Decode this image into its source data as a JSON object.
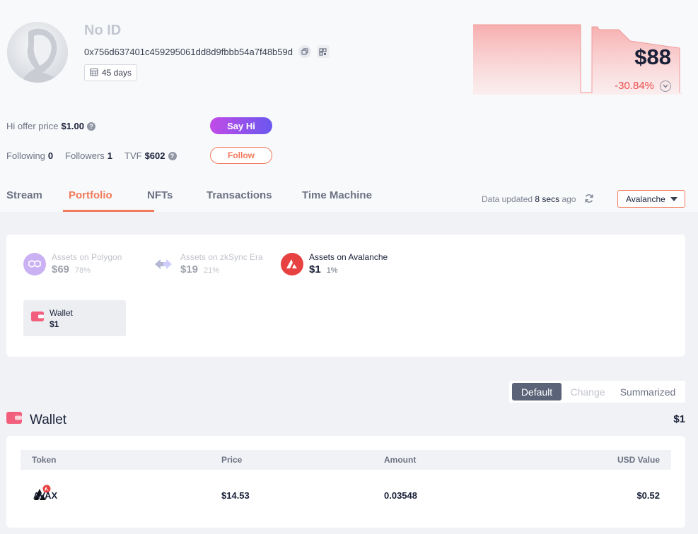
{
  "profile": {
    "name": "No ID",
    "address": "0x756d637401c459295061dd8d9fbbb54a7f48b59d",
    "age": "45 days",
    "net_worth": "$88",
    "change": "-30.84%"
  },
  "social": {
    "hi_offer_label": "Hi offer price",
    "hi_offer_value": "$1.00",
    "say_hi": "Say Hi",
    "following_label": "Following",
    "following_count": "0",
    "followers_label": "Followers",
    "followers_count": "1",
    "tvf_label": "TVF",
    "tvf_value": "$602",
    "follow": "Follow"
  },
  "tabs": [
    {
      "label": "Stream",
      "active": false
    },
    {
      "label": "Portfolio",
      "active": true
    },
    {
      "label": "NFTs",
      "active": false
    },
    {
      "label": "Transactions",
      "active": false
    },
    {
      "label": "Time Machine",
      "active": false
    }
  ],
  "data_updated": {
    "prefix": "Data updated",
    "value": "8 secs",
    "suffix": "ago"
  },
  "chain_selector": "Avalanche",
  "chains": [
    {
      "label": "Assets on Polygon",
      "value": "$69",
      "pct": "78%",
      "icon": "polygon-icon",
      "color": "#8247e5"
    },
    {
      "label": "Assets on zkSync Era",
      "value": "$19",
      "pct": "21%",
      "icon": "zksync-icon",
      "color": "#4e529a"
    },
    {
      "label": "Assets on Avalanche",
      "value": "$1",
      "pct": "1%",
      "icon": "avalanche-icon",
      "color": "#e84142"
    }
  ],
  "protocol": {
    "name": "Wallet",
    "value": "$1"
  },
  "views": [
    "Default",
    "Change",
    "Summarized"
  ],
  "wallet": {
    "title": "Wallet",
    "total": "$1",
    "columns": [
      "Token",
      "Price",
      "Amount",
      "USD Value"
    ],
    "rows": [
      {
        "token": "AVAX",
        "price": "$14.53",
        "amount": "0.03548",
        "usd_value": "$0.52"
      }
    ]
  },
  "colors": {
    "accent": "#f07a5b",
    "negative": "#ec4d4d",
    "say_hi_gradient": [
      "#c14be7",
      "#6a57ef"
    ],
    "wallet_icon": "#f25f7d"
  }
}
